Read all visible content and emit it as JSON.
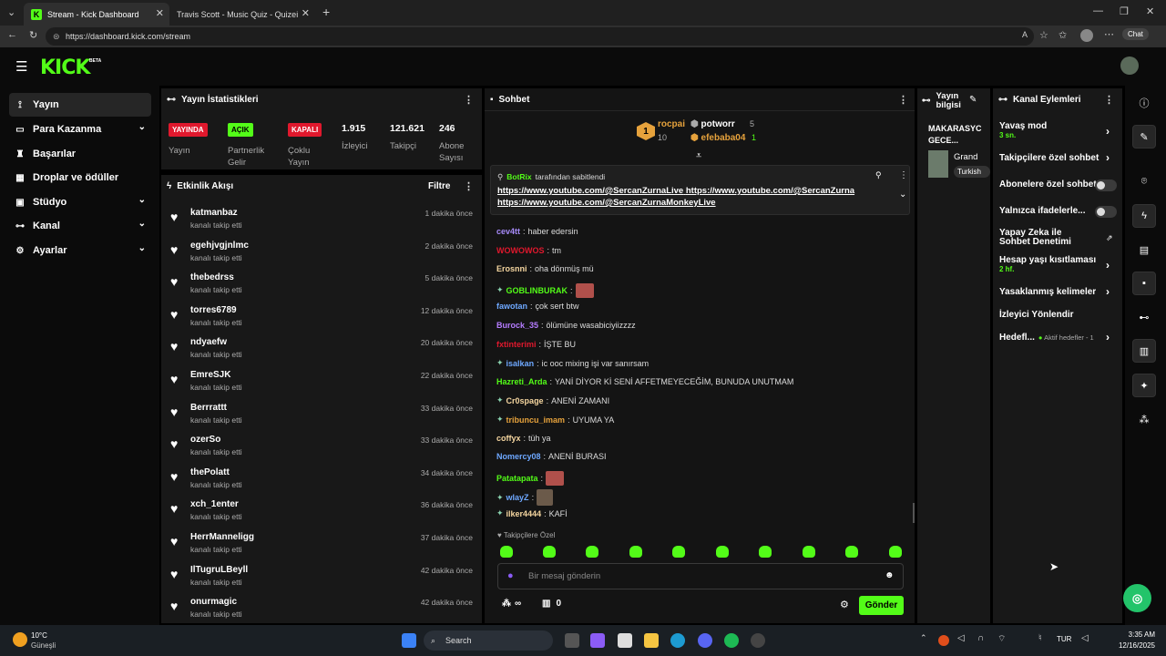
{
  "browser": {
    "tabs": [
      {
        "title": "Stream - Kick Dashboard",
        "active": true
      },
      {
        "title": "Travis Scott - Music Quiz - Quizei",
        "active": false
      }
    ],
    "url": "https://dashboard.kick.com/stream",
    "chat_button": "Chat"
  },
  "header": {
    "logo": "KICK",
    "beta": "BETA"
  },
  "sidebar": {
    "items": [
      {
        "label": "Yayın",
        "icon": "broadcast-icon",
        "active": true,
        "expandable": false
      },
      {
        "label": "Para Kazanma",
        "icon": "dollar-icon",
        "expandable": true
      },
      {
        "label": "Başarılar",
        "icon": "trophy-icon",
        "expandable": false
      },
      {
        "label": "Droplar ve ödüller",
        "icon": "gift-icon",
        "expandable": false
      },
      {
        "label": "Stüdyo",
        "icon": "studio-icon",
        "expandable": true
      },
      {
        "label": "Kanal",
        "icon": "channel-icon",
        "expandable": true
      },
      {
        "label": "Ayarlar",
        "icon": "gear-icon",
        "expandable": true
      }
    ]
  },
  "stats": {
    "title": "Yayın İstatistikleri",
    "items": [
      {
        "badge": "YAYINDA",
        "label": "Yayın",
        "badge_color": "#e0182d"
      },
      {
        "badge": "AÇIK",
        "label": "Partnerlik Gelir",
        "badge_color": "#53fc18"
      },
      {
        "badge": "KAPALI",
        "label": "Çoklu Yayın",
        "badge_color": "#e0182d"
      },
      {
        "value": "1.915",
        "label": "İzleyici"
      },
      {
        "value": "121.621",
        "label": "Takipçi"
      },
      {
        "value": "246",
        "label": "Abone Sayısı"
      }
    ]
  },
  "activity": {
    "title": "Etkinlik Akışı",
    "filter": "Filtre",
    "items": [
      {
        "name": "katmanbaz",
        "action": "kanalı takip etti",
        "time": "1 dakika önce"
      },
      {
        "name": "egehjvgjnlmc",
        "action": "kanalı takip etti",
        "time": "2 dakika önce"
      },
      {
        "name": "thebedrss",
        "action": "kanalı takip etti",
        "time": "5 dakika önce"
      },
      {
        "name": "torres6789",
        "action": "kanalı takip etti",
        "time": "12 dakika önce"
      },
      {
        "name": "ndyaefw",
        "action": "kanalı takip etti",
        "time": "20 dakika önce"
      },
      {
        "name": "EmreSJK",
        "action": "kanalı takip etti",
        "time": "22 dakika önce"
      },
      {
        "name": "Berrrattt",
        "action": "kanalı takip etti",
        "time": "33 dakika önce"
      },
      {
        "name": "ozerSo",
        "action": "kanalı takip etti",
        "time": "33 dakika önce"
      },
      {
        "name": "thePolatt",
        "action": "kanalı takip etti",
        "time": "34 dakika önce"
      },
      {
        "name": "xch_1enter",
        "action": "kanalı takip etti",
        "time": "36 dakika önce"
      },
      {
        "name": "HerrManneligg",
        "action": "kanalı takip etti",
        "time": "37 dakika önce"
      },
      {
        "name": "IlTugruLBeyll",
        "action": "kanalı takip etti",
        "time": "42 dakika önce"
      },
      {
        "name": "onurmagic",
        "action": "kanalı takip etti",
        "time": "42 dakika önce"
      }
    ]
  },
  "chat": {
    "title": "Sohbet",
    "leaderboard": {
      "first": {
        "rank": "1",
        "name": "rocpai",
        "count": "10"
      },
      "second": {
        "name": "potworr",
        "count": "5"
      },
      "third": {
        "name": "efebaba04",
        "count": "1"
      }
    },
    "pinned": {
      "by_user": "BotRix",
      "by_text": "tarafından sabitlendi",
      "line1a": "https://www.youtube.com/@SercanZurnaLive",
      "line1b": "https://www.youtube.com/@SercanZurna",
      "line2": "https://www.youtube.com/@SercanZurnaMonkeyLive"
    },
    "messages": [
      {
        "user": "cev4tt",
        "color": "#a78bfa",
        "text": "haber edersin"
      },
      {
        "user": "WOWOWOS",
        "color": "#e0182d",
        "text": "tm"
      },
      {
        "user": "Erosnni",
        "color": "#f5d6a0",
        "text": "oha dönmüş mü"
      },
      {
        "user": "GOBLINBURAK",
        "color": "#53fc18",
        "text": "",
        "emote": true,
        "badge": true
      },
      {
        "user": "fawotan",
        "color": "#6ea8ff",
        "text": "çok sert btw"
      },
      {
        "user": "Burock_35",
        "color": "#b57cff",
        "text": "ölümüne wasabiciyiizzzz"
      },
      {
        "user": "fxtinterimi",
        "color": "#e0182d",
        "text": "İŞTE BU"
      },
      {
        "user": "isalkan",
        "color": "#6ea8ff",
        "text": "ic ooc mixing işi var sanırsam",
        "badge": true
      },
      {
        "user": "Hazreti_Arda",
        "color": "#53fc18",
        "text": "YANİ DİYOR Kİ SENİ AFFETMEYECEĞİM, BUNUDA UNUTMAM"
      },
      {
        "user": "Cr0spage",
        "color": "#f5d6a0",
        "text": "ANENİ ZAMANI",
        "badge": true
      },
      {
        "user": "tribuncu_imam",
        "color": "#e6a23c",
        "text": "UYUMA YA",
        "badge": true
      },
      {
        "user": "coffyx",
        "color": "#f5d6a0",
        "text": "tüh ya"
      },
      {
        "user": "Nomercy08",
        "color": "#6ea8ff",
        "text": "ANENİ BURASI"
      },
      {
        "user": "Patatapata",
        "color": "#53fc18",
        "text": "",
        "emote": true
      },
      {
        "user": "wlayZ",
        "color": "#6ea8ff",
        "text": "",
        "emote2": true,
        "badge": true
      },
      {
        "user": "ilker4444",
        "color": "#f5d6a0",
        "text": "KAFİ",
        "badge": true
      }
    ],
    "followers_only": "Takipçilere Özel",
    "input_placeholder": "Bir mesaj gönderin",
    "footer_points": "∞",
    "footer_count": "0",
    "send_button": "Gönder"
  },
  "stream_info": {
    "title": "Yayın bilgisi",
    "stream_title": "MAKARASYC GECE...",
    "game": "Grand",
    "tag": "Turkish"
  },
  "channel_actions": {
    "title": "Kanal Eylemleri",
    "items": [
      {
        "label": "Yavaş mod",
        "sub": "3 sn.",
        "control": "arrow"
      },
      {
        "label": "Takipçilere özel sohbet",
        "control": "arrow"
      },
      {
        "label": "Abonelere özel sohbet",
        "control": "toggle"
      },
      {
        "label": "Yalnızca ifadelerle...",
        "control": "toggle"
      },
      {
        "label": "Yapay Zeka ile Sohbet Denetimi",
        "control": "external"
      },
      {
        "label": "Hesap yaşı kısıtlaması",
        "sub": "2 hf.",
        "control": "arrow"
      },
      {
        "label": "Yasaklanmış kelimeler",
        "control": "arrow"
      },
      {
        "label": "İzleyici Yönlendir",
        "control": "none"
      },
      {
        "label": "Hedefl...",
        "note": "Aktif hedefler - 1",
        "control": "arrow"
      }
    ]
  },
  "taskbar": {
    "weather_temp": "10°C",
    "weather_desc": "Güneşli",
    "search": "Search",
    "lang": "TUR",
    "time": "3:35 AM",
    "date": "12/16/2025"
  },
  "colors": {
    "accent": "#53fc18",
    "live": "#e0182d",
    "panel": "#181818"
  }
}
